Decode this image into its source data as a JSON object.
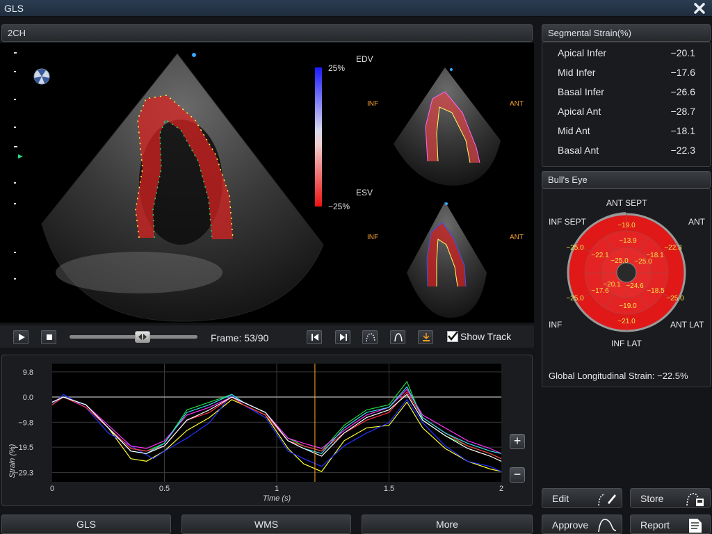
{
  "window": {
    "title": "GLS"
  },
  "viewer": {
    "view_label": "2CH",
    "scale_max": "25%",
    "scale_min": "−25%",
    "edv_label": "EDV",
    "esv_label": "ESV",
    "inf_label": "INF",
    "ant_label": "ANT"
  },
  "controls": {
    "frame_text": "Frame: 53/90",
    "frame_current": 53,
    "frame_total": 90,
    "show_track_label": "Show Track",
    "show_track_checked": true
  },
  "segmental": {
    "title": "Segmental Strain(%)",
    "rows": [
      {
        "name": "Apical Infer",
        "value": "−20.1"
      },
      {
        "name": "Mid Infer",
        "value": "−17.6"
      },
      {
        "name": "Basal Infer",
        "value": "−26.6"
      },
      {
        "name": "Apical Ant",
        "value": "−28.7"
      },
      {
        "name": "Mid Ant",
        "value": "−18.1"
      },
      {
        "name": "Basal Ant",
        "value": "−22.3"
      }
    ]
  },
  "bulls_eye": {
    "title": "Bull's Eye",
    "labels": {
      "ant_sept": "ANT SEPT",
      "ant": "ANT",
      "inf_sept": "INF SEPT",
      "inf": "INF",
      "ant_lat": "ANT LAT",
      "inf_lat": "INF LAT"
    },
    "values": {
      "basal_top": "−19.0",
      "basal_right": "−22.3",
      "basal_left": "−25.0",
      "basal_left_low": "−25.0",
      "basal_right_low": "−25.0",
      "basal_bottom": "−21.0",
      "mid_top": "−13.9",
      "mid_right": "−18.1",
      "mid_left": "−22.1",
      "mid_left_low": "−17.6",
      "mid_right_low": "−18.5",
      "mid_bottom": "−19.0",
      "apex_tl": "−25.0",
      "apex_tr": "−25.0",
      "apex_bl": "−20.1",
      "apex_br": "−24.6"
    },
    "gls_text": "Global Longitudinal Strain: −22.5%"
  },
  "chart_data": {
    "type": "line",
    "xlabel": "Time (s)",
    "ylabel": "Strain (%)",
    "xlim": [
      0,
      2
    ],
    "ylim": [
      -33,
      13
    ],
    "xticks": [
      "0",
      "0.5",
      "1",
      "1.5",
      "2"
    ],
    "yticks": [
      "9.8",
      "0.0",
      "−9.8",
      "−19.5",
      "−29.3"
    ],
    "ytick_values": [
      9.8,
      0,
      -9.8,
      -19.5,
      -29.3
    ],
    "cursor_x": 1.17,
    "colors": {
      "yellow": "#ffff33",
      "blue": "#2233ff",
      "green": "#22dd44",
      "magenta": "#ff33ff",
      "red": "#ff3344",
      "cyan": "#33ddee",
      "white": "#ffffff"
    },
    "series": [
      {
        "color": "#ffff33",
        "x": [
          0,
          0.05,
          0.15,
          0.25,
          0.35,
          0.42,
          0.5,
          0.6,
          0.7,
          0.8,
          0.85,
          0.95,
          1.05,
          1.12,
          1.2,
          1.3,
          1.4,
          1.5,
          1.58,
          1.65,
          1.75,
          1.85,
          1.95,
          2.0
        ],
        "y": [
          -2,
          0,
          -3,
          -12,
          -24,
          -25,
          -21,
          -13,
          -8,
          -1,
          -3,
          -7,
          -20,
          -26,
          -29,
          -17,
          -12,
          -11,
          -2,
          -12,
          -20,
          -25,
          -28,
          -29
        ]
      },
      {
        "color": "#2233ff",
        "x": [
          0,
          0.05,
          0.15,
          0.25,
          0.35,
          0.45,
          0.5,
          0.6,
          0.7,
          0.8,
          0.85,
          0.95,
          1.05,
          1.12,
          1.2,
          1.3,
          1.4,
          1.5,
          1.58,
          1.65,
          1.75,
          1.85,
          1.95,
          2.0
        ],
        "y": [
          -3,
          1,
          -4,
          -14,
          -19,
          -24,
          -21,
          -16,
          -10,
          1,
          -3,
          -8,
          -21,
          -24,
          -27,
          -19,
          -14,
          -10,
          -1,
          -10,
          -19,
          -25,
          -27,
          -29
        ]
      },
      {
        "color": "#22dd44",
        "x": [
          0,
          0.05,
          0.15,
          0.25,
          0.35,
          0.42,
          0.5,
          0.6,
          0.7,
          0.8,
          0.85,
          0.95,
          1.05,
          1.12,
          1.2,
          1.3,
          1.4,
          1.5,
          1.58,
          1.65,
          1.75,
          1.85,
          1.95,
          2.0
        ],
        "y": [
          -3,
          0,
          -3,
          -12,
          -20,
          -21,
          -18,
          -5,
          -2,
          1,
          -2,
          -6,
          -16,
          -19,
          -21,
          -11,
          -5,
          -3,
          6,
          -9,
          -15,
          -19,
          -22,
          -24
        ]
      },
      {
        "color": "#ff33ff",
        "x": [
          0,
          0.05,
          0.15,
          0.25,
          0.35,
          0.42,
          0.5,
          0.6,
          0.7,
          0.8,
          0.85,
          0.95,
          1.05,
          1.12,
          1.2,
          1.3,
          1.4,
          1.5,
          1.58,
          1.65,
          1.75,
          1.85,
          1.95,
          2.0
        ],
        "y": [
          -2,
          0,
          -3,
          -11,
          -19,
          -20,
          -17,
          -7,
          -4,
          0,
          -2,
          -6,
          -16,
          -18,
          -20,
          -13,
          -7,
          -4,
          3,
          -7,
          -12,
          -17,
          -20,
          -22
        ]
      },
      {
        "color": "#ff3344",
        "x": [
          0,
          0.05,
          0.15,
          0.25,
          0.35,
          0.42,
          0.5,
          0.6,
          0.7,
          0.8,
          0.85,
          0.95,
          1.05,
          1.12,
          1.2,
          1.3,
          1.4,
          1.5,
          1.58,
          1.65,
          1.75,
          1.85,
          1.95,
          2.0
        ],
        "y": [
          -3,
          0,
          -4,
          -12,
          -20,
          -21,
          -19,
          -9,
          -6,
          0,
          -3,
          -7,
          -17,
          -19,
          -21,
          -14,
          -9,
          -6,
          2,
          -8,
          -14,
          -19,
          -22,
          -24
        ]
      },
      {
        "color": "#33ddee",
        "x": [
          0,
          0.05,
          0.15,
          0.25,
          0.35,
          0.42,
          0.5,
          0.6,
          0.7,
          0.8,
          0.85,
          0.95,
          1.05,
          1.12,
          1.2,
          1.3,
          1.4,
          1.5,
          1.58,
          1.65,
          1.75,
          1.85,
          1.95,
          2.0
        ],
        "y": [
          -2,
          0,
          -3,
          -12,
          -21,
          -22,
          -18,
          -6,
          -3,
          1,
          -2,
          -6,
          -17,
          -20,
          -22,
          -12,
          -6,
          -4,
          4,
          -8,
          -14,
          -18,
          -21,
          -22
        ]
      },
      {
        "color": "#ffffff",
        "x": [
          0,
          0.05,
          0.15,
          0.25,
          0.35,
          0.42,
          0.5,
          0.6,
          0.7,
          0.8,
          0.85,
          0.95,
          1.05,
          1.12,
          1.2,
          1.3,
          1.4,
          1.5,
          1.58,
          1.65,
          1.75,
          1.85,
          1.95,
          2.0
        ],
        "y": [
          -2,
          0,
          -3,
          -12,
          -21,
          -22,
          -19,
          -9,
          -5,
          0,
          -2,
          -6,
          -17,
          -20,
          -23,
          -14,
          -8,
          -5,
          1,
          -9,
          -15,
          -20,
          -23,
          -25
        ]
      }
    ]
  },
  "tabs": [
    {
      "label": "GLS"
    },
    {
      "label": "WMS"
    },
    {
      "label": "More"
    }
  ],
  "actions": {
    "edit": "Edit",
    "store": "Store",
    "approve": "Approve",
    "report": "Report"
  }
}
